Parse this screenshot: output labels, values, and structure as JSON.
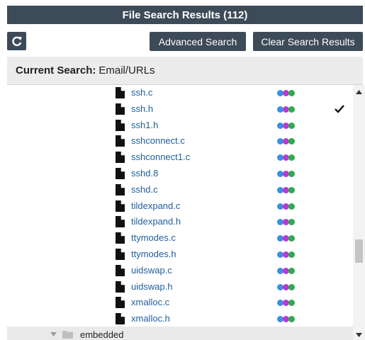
{
  "header": {
    "title": "File Search Results (112)"
  },
  "toolbar": {
    "refresh_icon": "refresh-icon",
    "advanced_label": "Advanced Search",
    "clear_label": "Clear Search Results"
  },
  "search": {
    "label": "Current Search:",
    "value": "Email/URLs"
  },
  "colors": {
    "dot_blue": "#3a8ee6",
    "dot_purple": "#b53bd1",
    "dot_green": "#2eab4f",
    "link": "#1f5e9c",
    "header_bg": "#3d4a57"
  },
  "files": [
    {
      "name": "ssh.c",
      "checked": false
    },
    {
      "name": "ssh.h",
      "checked": true
    },
    {
      "name": "ssh1.h",
      "checked": false
    },
    {
      "name": "sshconnect.c",
      "checked": false
    },
    {
      "name": "sshconnect1.c",
      "checked": false
    },
    {
      "name": "sshd.8",
      "checked": false
    },
    {
      "name": "sshd.c",
      "checked": false
    },
    {
      "name": "tildexpand.c",
      "checked": false
    },
    {
      "name": "tildexpand.h",
      "checked": false
    },
    {
      "name": "ttymodes.c",
      "checked": false
    },
    {
      "name": "ttymodes.h",
      "checked": false
    },
    {
      "name": "uidswap.c",
      "checked": false
    },
    {
      "name": "uidswap.h",
      "checked": false
    },
    {
      "name": "xmalloc.c",
      "checked": false
    },
    {
      "name": "xmalloc.h",
      "checked": false
    }
  ],
  "folder": {
    "label": "embedded",
    "expanded": true
  },
  "scrollbar": {
    "position": 0.6
  }
}
